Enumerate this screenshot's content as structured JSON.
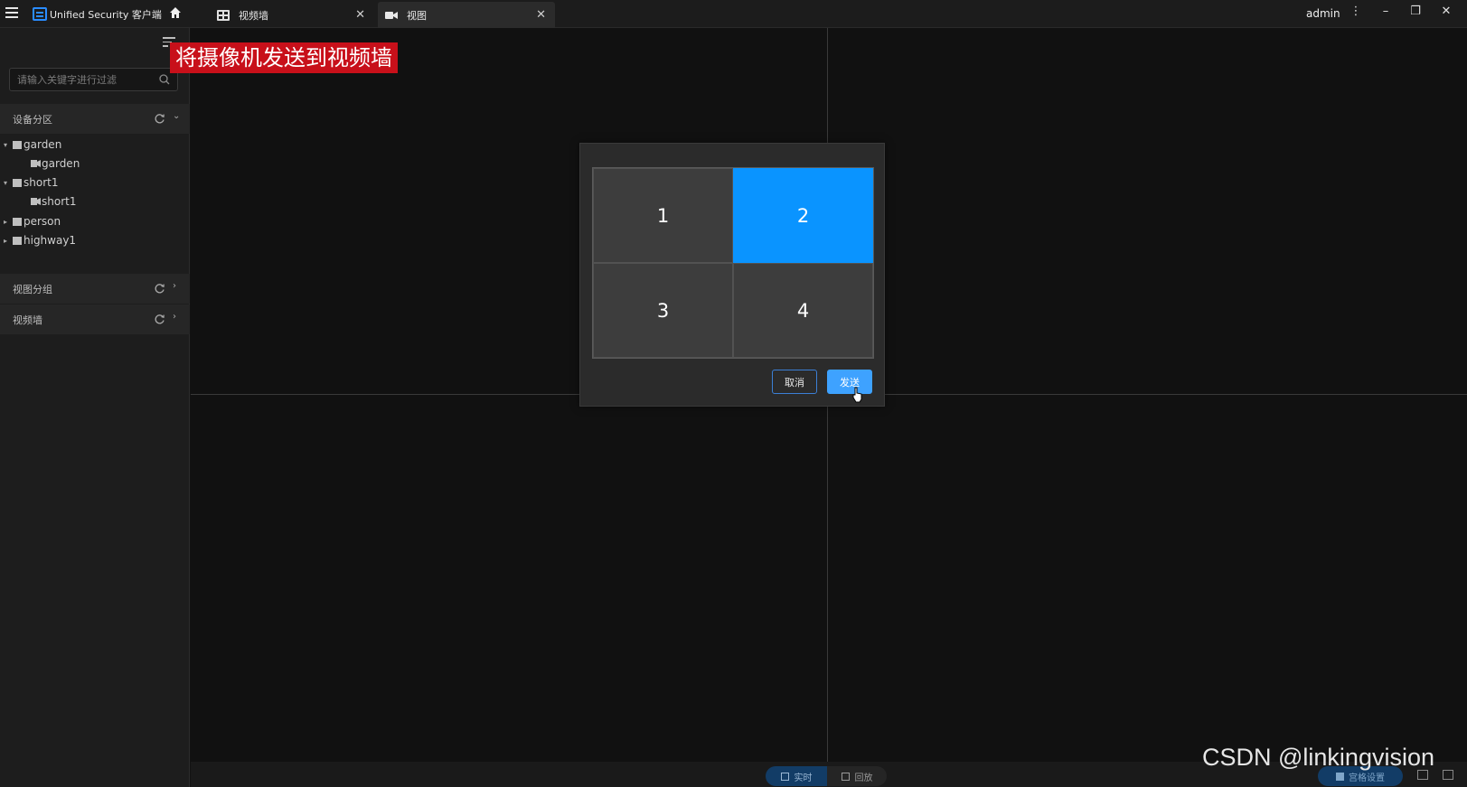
{
  "titlebar": {
    "app_title": "Unified Security 客户端",
    "tabs": [
      {
        "label": "视频墙",
        "close": "✕"
      },
      {
        "label": "视图",
        "close": "✕"
      }
    ],
    "user": "admin",
    "controls": {
      "more": "⋮",
      "minimize": "–",
      "restore": "❐",
      "close": "✕"
    }
  },
  "sidebar": {
    "search": {
      "placeholder": "请输入关键字进行过滤"
    },
    "sections": [
      {
        "label": "设备分区",
        "expanded": true,
        "chevron": "⌄"
      },
      {
        "label": "视图分组",
        "expanded": false,
        "chevron": "›"
      },
      {
        "label": "视频墙",
        "expanded": false,
        "chevron": "›"
      }
    ],
    "tree": [
      {
        "label": "garden",
        "type": "folder",
        "arrow": "▾"
      },
      {
        "label": "garden",
        "type": "camera"
      },
      {
        "label": "short1",
        "type": "folder",
        "arrow": "▾"
      },
      {
        "label": "short1",
        "type": "camera"
      },
      {
        "label": "person",
        "type": "folder",
        "arrow": "▸"
      },
      {
        "label": "highway1",
        "type": "folder",
        "arrow": "▸"
      }
    ]
  },
  "caption": "将摄像机发送到视频墙",
  "dialog": {
    "cells": [
      "1",
      "2",
      "3",
      "4"
    ],
    "selected_cell": "2",
    "cancel_label": "取消",
    "send_label": "发送"
  },
  "footer": {
    "live_label": "实时",
    "playback_label": "回放",
    "grid_settings_label": "宫格设置"
  },
  "watermark": "CSDN @linkingvision",
  "colors": {
    "accent": "#0a94ff",
    "caption_bg": "#c8101a",
    "background": "#111111"
  }
}
